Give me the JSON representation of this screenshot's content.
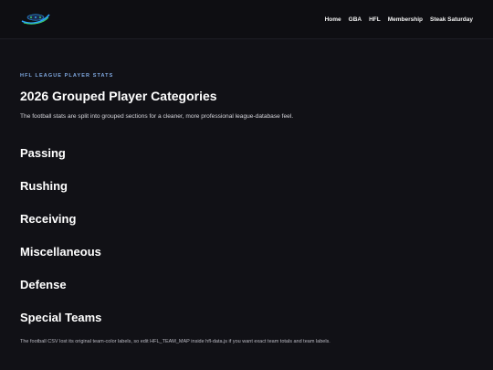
{
  "nav": {
    "logo_icon": "site-logo",
    "brand_colors": [
      "#2aa3ff",
      "#3ecf6c"
    ],
    "items": [
      "Home",
      "GBA",
      "HFL",
      "Membership",
      "Steak Saturday"
    ]
  },
  "header": {
    "eyebrow": "HFL LEAGUE PLAYER STATS",
    "title": "2026 Grouped Player Categories",
    "intro": "The football stats are split into grouped sections for a cleaner, more professional league-database feel."
  },
  "categories": [
    "Passing",
    "Rushing",
    "Receiving",
    "Miscellaneous",
    "Defense",
    "Special Teams"
  ],
  "footnote": "The football CSV lost its original team-color labels, so edit HFL_TEAM_MAP inside hfl-data.js if you want exact team totals and team labels.",
  "colors": {
    "background": "#111116",
    "topbar": "#0e0e12",
    "eyebrow": "#7fa8e0"
  }
}
